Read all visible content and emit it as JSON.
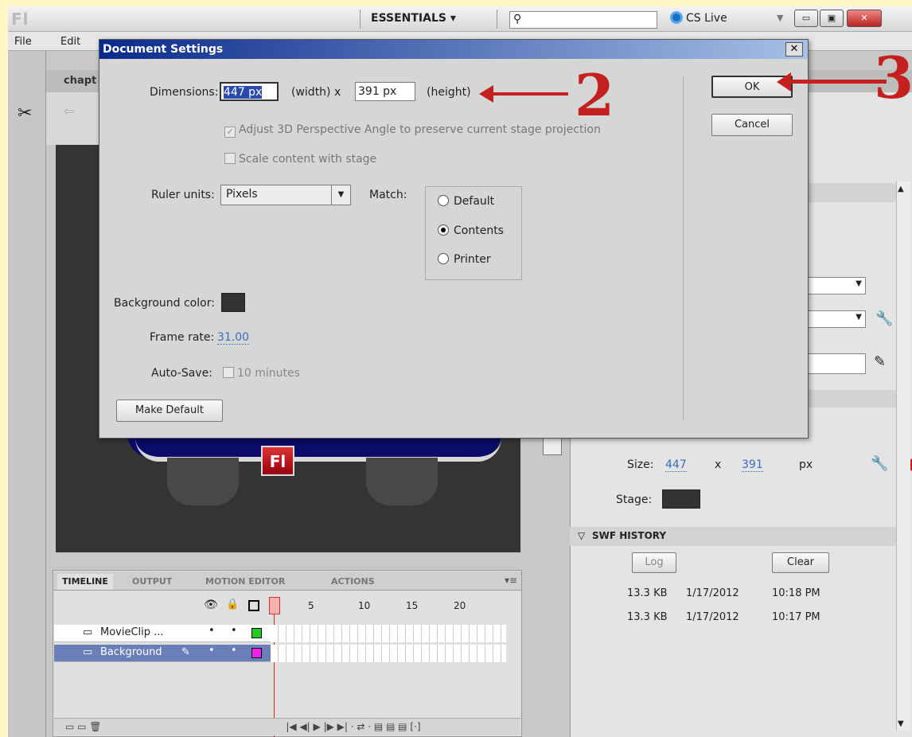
{
  "app": {
    "logo": "Fl",
    "workspace": "ESSENTIALS",
    "cs_live": "CS Live"
  },
  "menu": [
    "File",
    "Edit"
  ],
  "doc_tab": "chapt",
  "timeline": {
    "tabs": [
      "TIMELINE",
      "OUTPUT",
      "MOTION EDITOR",
      "ACTIONS"
    ],
    "frame_numbers": [
      "5",
      "10",
      "15",
      "20"
    ],
    "layers": [
      {
        "name": "MovieClip ...",
        "color": "#22cc22"
      },
      {
        "name": "Background",
        "color": "#ee22ee"
      }
    ]
  },
  "stage_badge": "Fl",
  "properties": {
    "size_label": "Size:",
    "width": "447",
    "x": "x",
    "height": "391",
    "unit": "px",
    "stage_label": "Stage:",
    "stage_color": "#333333",
    "swf_history_title": "SWF HISTORY",
    "log_button": "Log",
    "clear_button": "Clear",
    "history": [
      {
        "size": "13.3 KB",
        "date": "1/17/2012",
        "time": "10:18 PM"
      },
      {
        "size": "13.3 KB",
        "date": "1/17/2012",
        "time": "10:17 PM"
      }
    ]
  },
  "dialog": {
    "title": "Document Settings",
    "dimensions_label": "Dimensions:",
    "width_value": "447 px",
    "width_label": "(width)  x",
    "height_value": "391 px",
    "height_label": "(height)",
    "adjust_3d_label": "Adjust 3D Perspective Angle to preserve current stage projection",
    "scale_label": "Scale content with stage",
    "ruler_label": "Ruler units:",
    "ruler_value": "Pixels",
    "match_label": "Match:",
    "match_options": [
      "Default",
      "Contents",
      "Printer"
    ],
    "match_selected": "Contents",
    "bg_label": "Background color:",
    "bg_color": "#333333",
    "frame_rate_label": "Frame rate:",
    "frame_rate_value": "31.00",
    "autosave_label": "Auto-Save:",
    "autosave_value": "10 minutes",
    "make_default": "Make Default",
    "ok": "OK",
    "cancel": "Cancel"
  },
  "annotations": {
    "two": "2",
    "three": "3"
  }
}
